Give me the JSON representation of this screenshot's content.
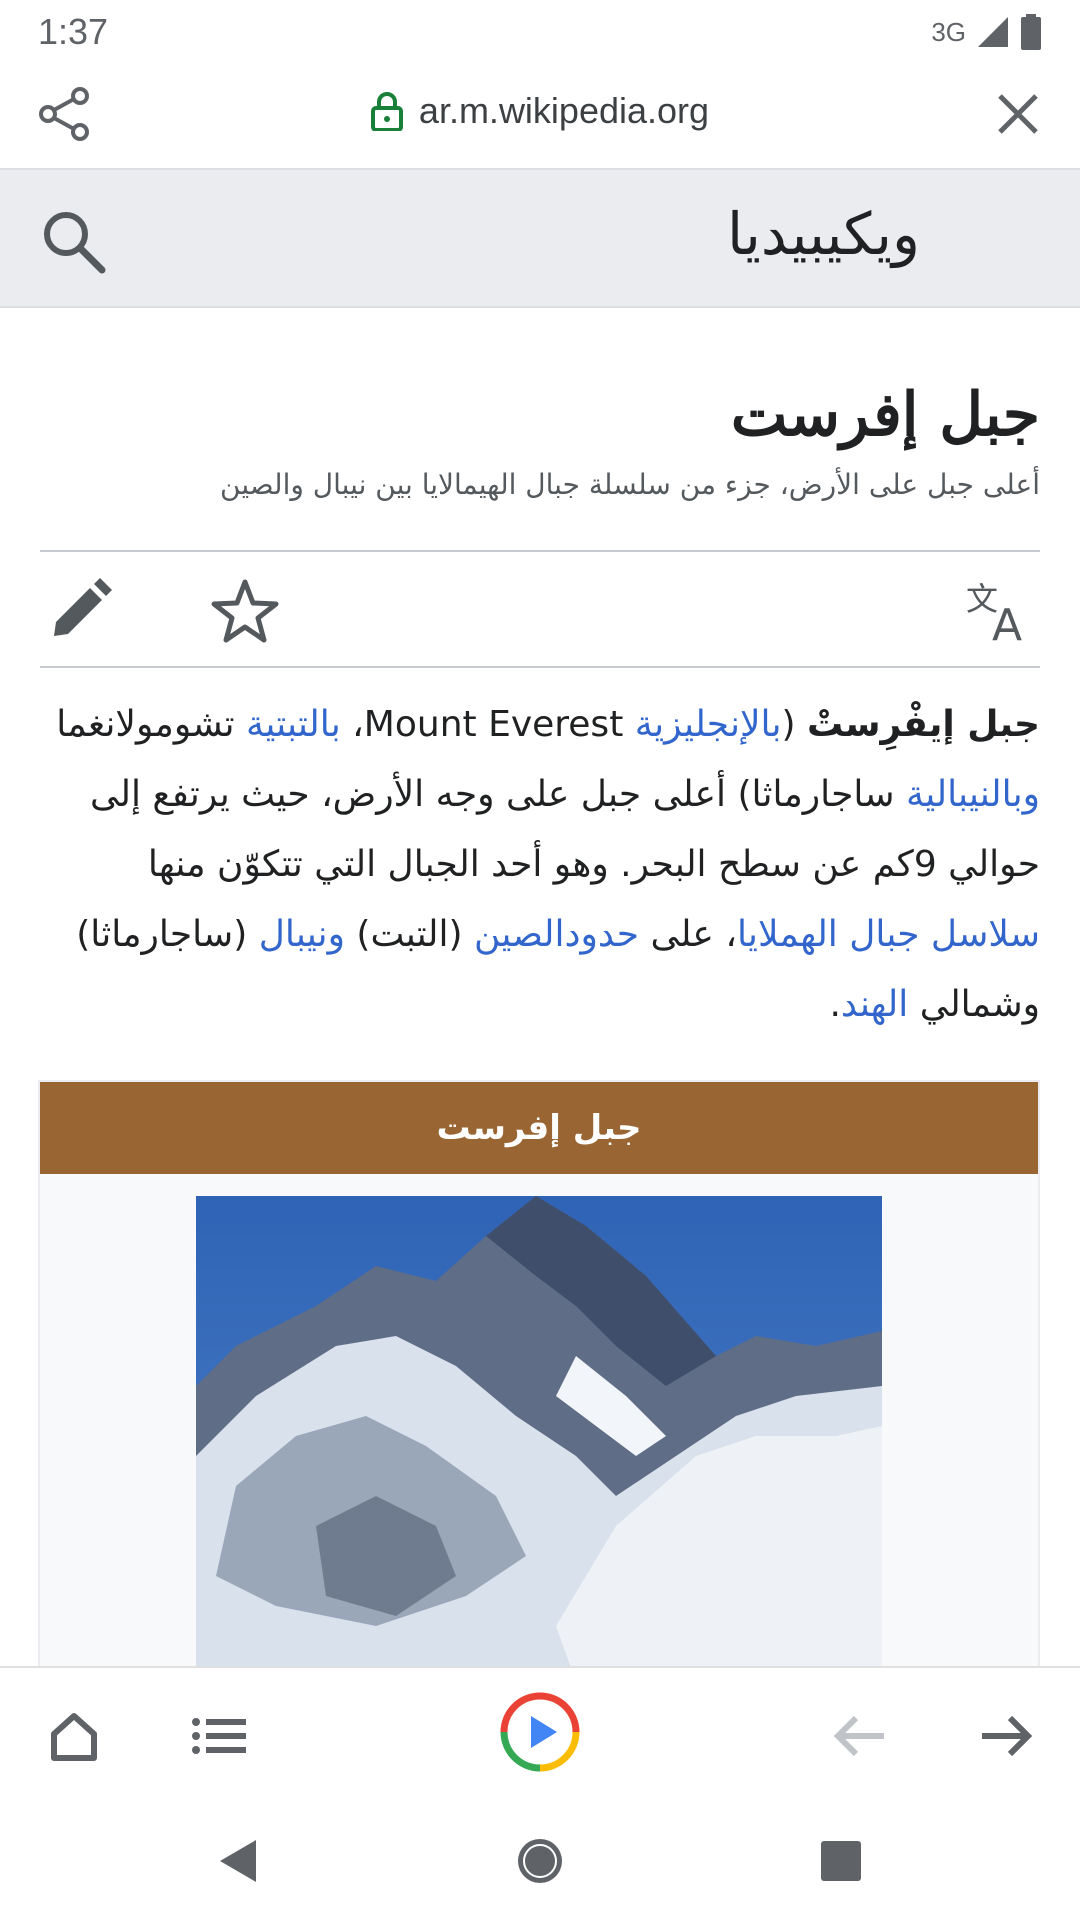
{
  "status_bar": {
    "time": "1:37",
    "network": "3G"
  },
  "toolbar": {
    "url": "ar.m.wikipedia.org"
  },
  "wiki_header": {
    "brand": "ويكيبيديا"
  },
  "article": {
    "title": "جبل إفرست",
    "description": "أعلى جبل على الأرض، جزء من سلسلة جبال الهيمالايا بين نيبال والصين",
    "intro": {
      "bold_name": "جبل إيفْرِستْ",
      "open_paren": " (",
      "link_english": "بالإنجليزية",
      "english_name": " Mount Everest، ",
      "link_tibetan": "بالتبتية",
      "tibetan_name": " تشومولانغما ",
      "link_nepali": "وبالنيبالية",
      "text1": " ساجارماثا) أعلى جبل على وجه الأرض، حيث يرتفع إلى حوالي 9كم عن سطح البحر. وهو أحد الجبال التي تتكوّن منها ",
      "link_himalaya": "سلاسل جبال الهملايا",
      "text2": "، على ",
      "link_china_border": "حدودالصين",
      "text3": " (التبت) ",
      "link_nepal": "ونيبال",
      "text4": " (ساجارماثا) وشمالي ",
      "link_india": "الهند",
      "text5": "."
    },
    "infobox": {
      "title": "جبل إفرست"
    }
  },
  "icons": {
    "share": "share-icon",
    "lock": "lock-icon",
    "close": "close-icon",
    "search": "search-icon",
    "edit": "pencil-icon",
    "watch": "star-icon",
    "language": "translate-icon",
    "home": "home-icon",
    "list": "list-icon",
    "play": "play-icon",
    "back": "arrow-left-icon",
    "forward": "arrow-right-icon"
  },
  "colors": {
    "link": "#3366cc",
    "infobox_header": "#996633",
    "header_bg": "#eaecf0",
    "lock_green": "#188038"
  }
}
